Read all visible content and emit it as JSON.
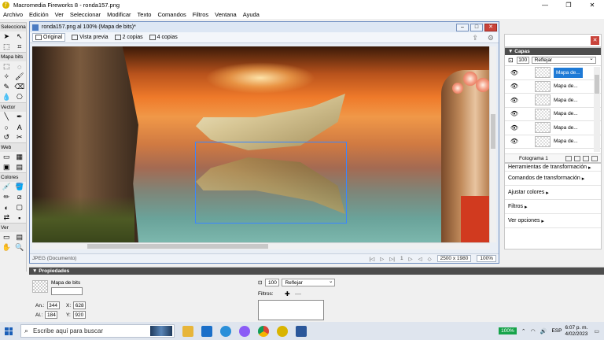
{
  "window": {
    "title": "Macromedia Fireworks 8 - ronda157.png",
    "app_icon": "fireworks-logo",
    "controls": [
      "—",
      "❐",
      "✕"
    ]
  },
  "menu": [
    "Archivo",
    "Edición",
    "Ver",
    "Seleccionar",
    "Modificar",
    "Texto",
    "Comandos",
    "Filtros",
    "Ventana",
    "Ayuda"
  ],
  "tools": {
    "sections": [
      "Seleccionar",
      "Mapa bits",
      "Vector",
      "Web",
      "Colores",
      "Ver"
    ]
  },
  "document": {
    "title": "ronda157.png al 100% (Mapa de bits)*",
    "tabs": [
      {
        "label": "Original"
      },
      {
        "label": "Vista previa"
      },
      {
        "label": "2 copias"
      },
      {
        "label": "4 copias"
      }
    ],
    "status": {
      "format": "JPEG (Documento)",
      "frame": "1",
      "size": "2500 x 1980",
      "zoom": "100%"
    }
  },
  "layers": {
    "title": "Capas",
    "opacity": "100",
    "blend": "Reflejar",
    "items": [
      {
        "name": "Mapa de..."
      },
      {
        "name": "Mapa de..."
      },
      {
        "name": "Mapa de..."
      },
      {
        "name": "Mapa de..."
      },
      {
        "name": "Mapa de..."
      },
      {
        "name": "Mapa de..."
      }
    ],
    "frame_label": "Fotograma 1"
  },
  "right_panels": [
    "Herramientas de transformación",
    "Comandos de transformación",
    "Ajustar colores",
    "Filtros",
    "Ver opciones"
  ],
  "properties": {
    "title": "Propiedades",
    "object_type": "Mapa de bits",
    "width_label": "An.:",
    "width": "344",
    "height_label": "Al.:",
    "height": "184",
    "x_label": "X:",
    "x": "628",
    "y_label": "Y:",
    "y": "920",
    "opacity": "100",
    "blend": "Reflejar",
    "filters_label": "Filtros:"
  },
  "taskbar": {
    "search_placeholder": "Escribe aquí para buscar",
    "battery": "100%",
    "lang": "ESP",
    "time": "6:07 p. m.",
    "date": "4/02/2023"
  }
}
